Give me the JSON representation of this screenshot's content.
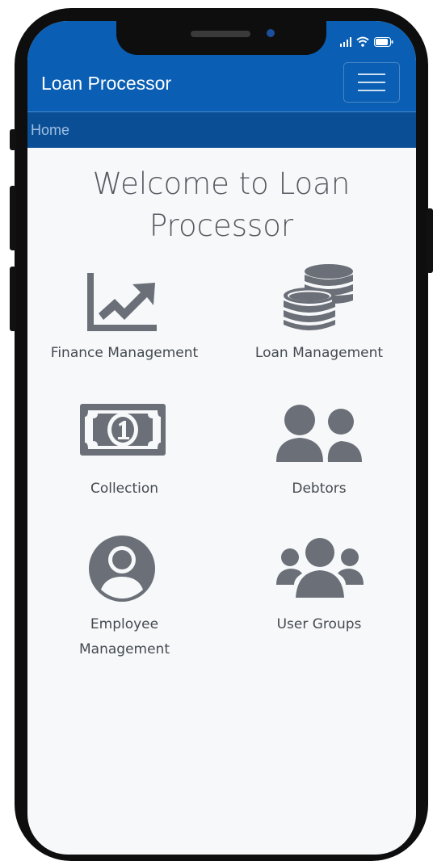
{
  "app": {
    "title": "Loan Processor"
  },
  "breadcrumb": {
    "home": "Home"
  },
  "main": {
    "heading_line1": "Welcome to Loan",
    "heading_line2": "Processor"
  },
  "tiles": [
    {
      "icon": "chart-line-icon",
      "label": "Finance Management"
    },
    {
      "icon": "coins-icon",
      "label": "Loan Management"
    },
    {
      "icon": "money-bill-icon",
      "label": "Collection"
    },
    {
      "icon": "user-pair-icon",
      "label": "Debtors"
    },
    {
      "icon": "user-circle-icon",
      "label_line1": "Employee",
      "label_line2": "Management"
    },
    {
      "icon": "users-group-icon",
      "label": "User Groups"
    }
  ],
  "colors": {
    "appbar": "#0a5fb4",
    "breadcrumb_bar": "#0a4f96",
    "icon": "#6b7078",
    "background": "#f7f8fa"
  }
}
